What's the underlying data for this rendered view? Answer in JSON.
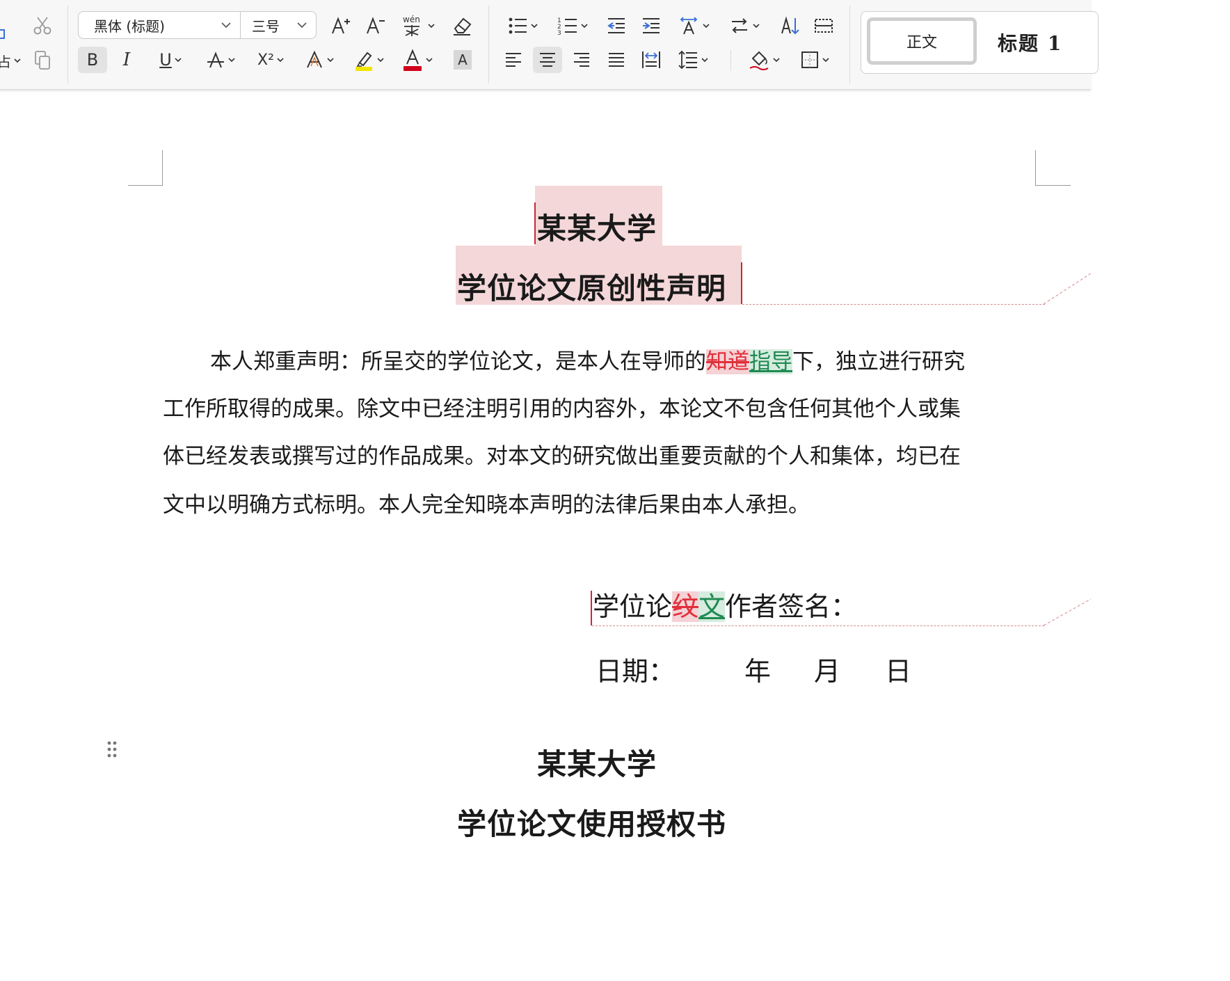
{
  "toolbar": {
    "font_name": "黑体 (标题)",
    "font_size": "三号",
    "paste_fragment": "占",
    "bold_label": "B",
    "italic_label": "I",
    "underline_label": "U",
    "superscript_label": "X²",
    "char_shading_label": "A",
    "phonetic_label": "wén",
    "styles": {
      "normal": "正文",
      "heading1": "标题 1"
    }
  },
  "colors": {
    "highlight": "#f2e600",
    "font_color": "#d0021b",
    "deletion": "#e0303b",
    "insertion": "#1f8a52",
    "change_bg": "#f4d7d9"
  },
  "document": {
    "title1": "某某大学",
    "title2": "学位论文原创性声明",
    "paragraph": {
      "line1_a": "本人郑重声明：所呈交的学位论文，是本人在导师的",
      "line1_del": "知道",
      "line1_ins": "指导",
      "line1_b": "下，独立进行研究",
      "line2": "工作所取得的成果。除文中已经注明引用的内容外，本论文不包含任何其他个人或集",
      "line3": "体已经发表或撰写过的作品成果。对本文的研究做出重要贡献的个人和集体，均已在",
      "line4": "文中以明确方式标明。本人完全知晓本声明的法律后果由本人承担。"
    },
    "signature": {
      "a": "学位论",
      "del": "纹",
      "ins": "文",
      "b": "作者签名："
    },
    "date": {
      "label": "日期：",
      "year": "年",
      "month": "月",
      "day": "日"
    },
    "title3": "某某大学",
    "title4": "学位论文使用授权书"
  }
}
